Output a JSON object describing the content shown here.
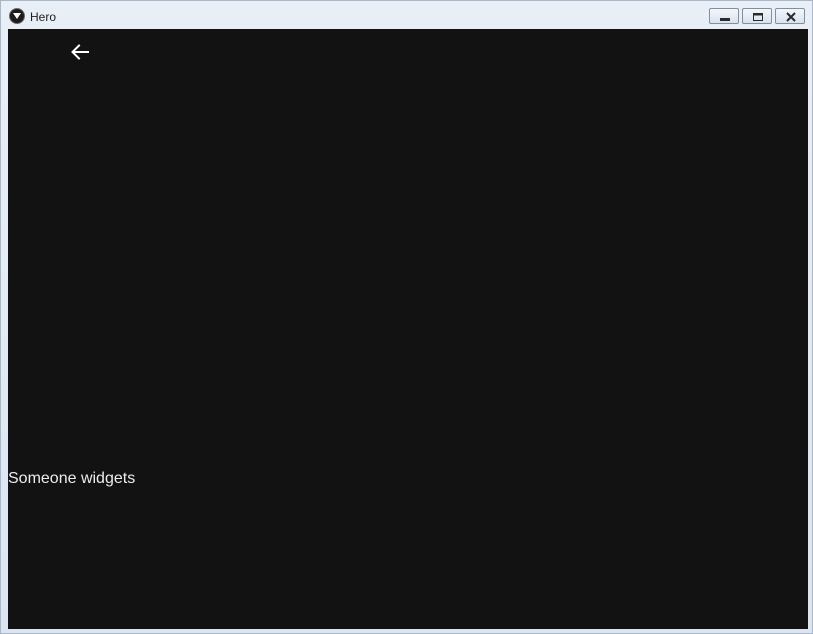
{
  "window": {
    "title": "Hero",
    "icons": {
      "app": "app-icon",
      "minimize": "minimize-icon",
      "maximize": "maximize-icon",
      "close": "close-icon"
    }
  },
  "app_bar": {
    "back_icon": "arrow-back-icon"
  },
  "content": {
    "hero_text": "Someone widgets"
  },
  "colors": {
    "background": "#121212",
    "text": "#ececec",
    "icon": "#ffffff"
  }
}
